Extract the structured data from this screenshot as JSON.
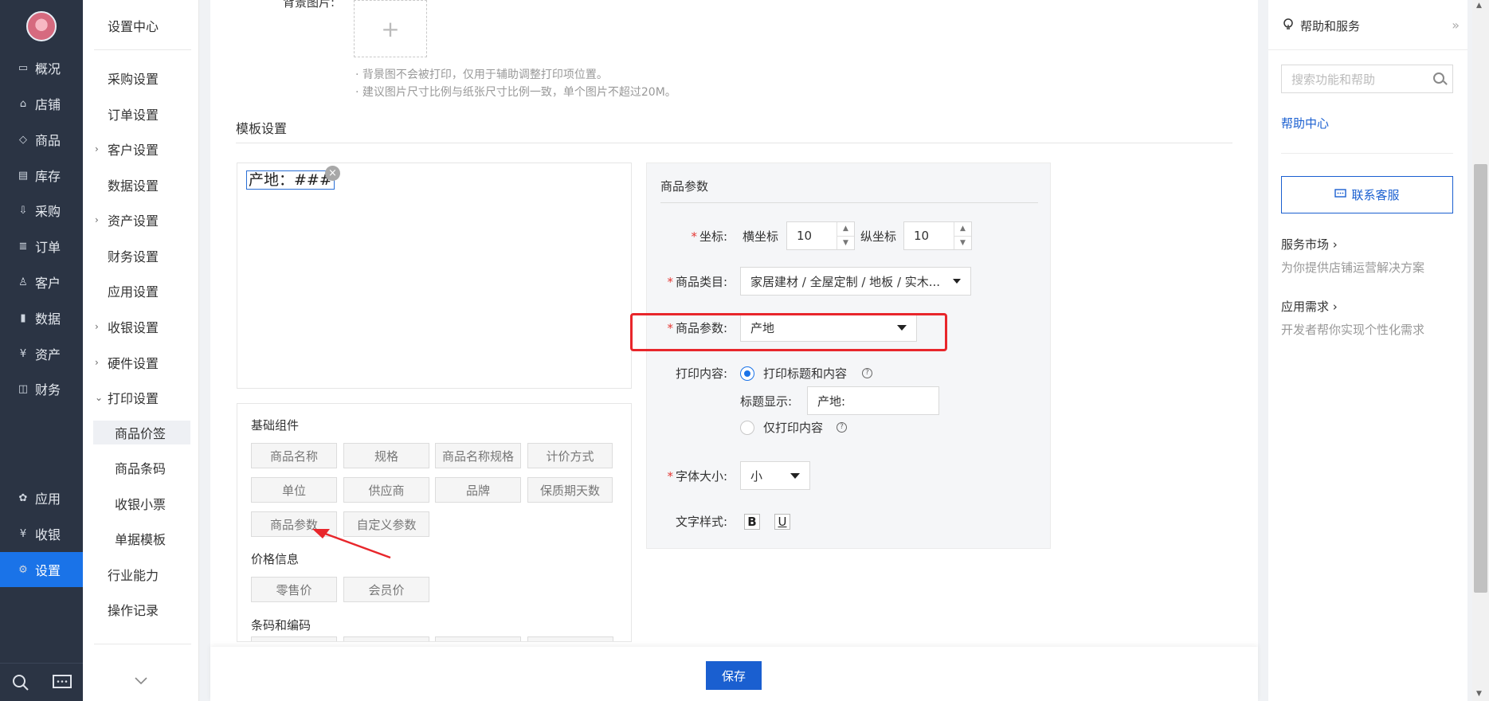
{
  "leftnav": {
    "items": [
      {
        "label": "概况",
        "icon": "overview-icon",
        "glyph": "▭"
      },
      {
        "label": "店铺",
        "icon": "store-icon",
        "glyph": "⌂"
      },
      {
        "label": "商品",
        "icon": "tag-icon",
        "glyph": "◇"
      },
      {
        "label": "库存",
        "icon": "inventory-icon",
        "glyph": "▤"
      },
      {
        "label": "采购",
        "icon": "purchase-icon",
        "glyph": "⇩"
      },
      {
        "label": "订单",
        "icon": "order-icon",
        "glyph": "≣"
      },
      {
        "label": "客户",
        "icon": "customer-icon",
        "glyph": "♙"
      },
      {
        "label": "数据",
        "icon": "data-icon",
        "glyph": "▮"
      },
      {
        "label": "资产",
        "icon": "asset-icon",
        "glyph": "¥"
      },
      {
        "label": "财务",
        "icon": "finance-icon",
        "glyph": "◫"
      }
    ],
    "bottom_items": [
      {
        "label": "应用",
        "icon": "apps-icon",
        "glyph": "✿"
      },
      {
        "label": "收银",
        "icon": "cashier-icon",
        "glyph": "¥"
      },
      {
        "label": "设置",
        "icon": "gear-icon",
        "glyph": "⚙"
      }
    ]
  },
  "submenu": {
    "title": "设置中心",
    "items": [
      {
        "label": "采购设置",
        "caret": ""
      },
      {
        "label": "订单设置",
        "caret": ""
      },
      {
        "label": "客户设置",
        "caret": "›"
      },
      {
        "label": "数据设置",
        "caret": ""
      },
      {
        "label": "资产设置",
        "caret": "›"
      },
      {
        "label": "财务设置",
        "caret": ""
      },
      {
        "label": "应用设置",
        "caret": ""
      },
      {
        "label": "收银设置",
        "caret": "›"
      },
      {
        "label": "硬件设置",
        "caret": "›"
      },
      {
        "label": "打印设置",
        "caret": "⌄"
      }
    ],
    "children": [
      "商品价签",
      "商品条码",
      "收银小票",
      "单据模板"
    ],
    "after": [
      "行业能力",
      "操作记录"
    ]
  },
  "main": {
    "upload_label": "背景图片:",
    "upload_plus": "+",
    "hints": [
      "· 背景图不会被打印，仅用于辅助调整打印项位置。",
      "· 建议图片尺寸比例与纸张尺寸比例一致，单个图片不超过20M。"
    ],
    "section_title": "模板设置",
    "preview_chip": "产地：###",
    "groups": [
      {
        "title": "基础组件",
        "buttons": [
          "商品名称",
          "规格",
          "商品名称规格",
          "计价方式",
          "单位",
          "供应商",
          "品牌",
          "保质期天数",
          "商品参数",
          "自定义参数"
        ]
      },
      {
        "title": "价格信息",
        "buttons": [
          "零售价",
          "会员价"
        ]
      },
      {
        "title": "条码和编码",
        "buttons": []
      }
    ]
  },
  "params": {
    "title": "商品参数",
    "coord_label": "坐标:",
    "x_label": "横坐标",
    "x_value": "10",
    "y_label": "纵坐标",
    "y_value": "10",
    "category_label": "商品类目:",
    "category_value": "家居建材 / 全屋定制 / 地板 / 实木...",
    "param_label": "商品参数:",
    "param_value": "产地",
    "print_label": "打印内容:",
    "print_opt1": "打印标题和内容",
    "title_show_label": "标题显示:",
    "title_show_value": "产地:",
    "print_opt2": "仅打印内容",
    "font_label": "字体大小:",
    "font_value": "小",
    "style_label": "文字样式:",
    "bold": "B",
    "underline": "U",
    "required_mark": "*",
    "help_mark": "?"
  },
  "footer": {
    "save": "保存"
  },
  "help": {
    "title": "帮助和服务",
    "collapse": "»",
    "search_placeholder": "搜索功能和帮助",
    "help_center": "帮助中心",
    "contact": "联系客服",
    "service_market": "服务市场 ›",
    "service_market_desc": "为你提供店铺运营解决方案",
    "app_needs": "应用需求 ›",
    "app_needs_desc": "开发者帮你实现个性化需求"
  },
  "colors": {
    "accent": "#1a73e8",
    "annotation": "#e8262b",
    "nav_bg": "#2b3444"
  }
}
